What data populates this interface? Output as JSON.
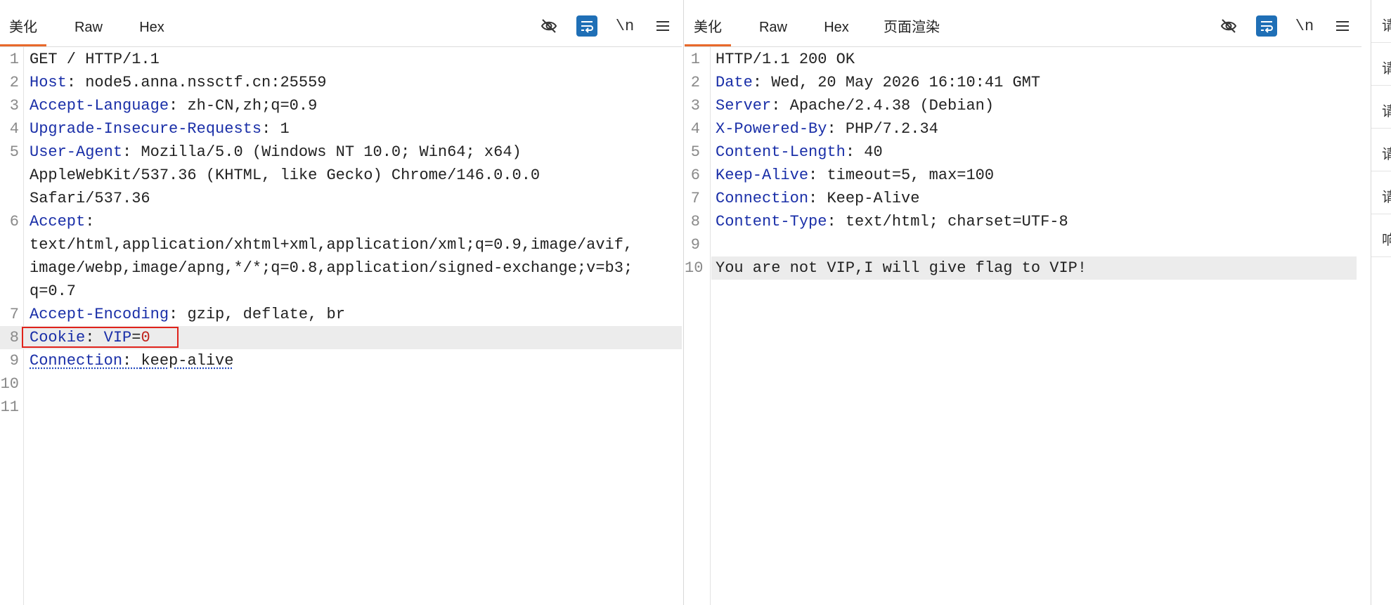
{
  "request": {
    "tabs": [
      {
        "label": "美化",
        "active": true
      },
      {
        "label": "Raw",
        "active": false
      },
      {
        "label": "Hex",
        "active": false
      }
    ],
    "tools": {
      "eye_off": "eye-off-icon",
      "wrap": "wrap-icon",
      "newline": "\\n",
      "menu": "menu-icon"
    },
    "lines": [
      {
        "num": "1",
        "text": "GET / HTTP/1.1"
      },
      {
        "num": "2",
        "key": "Host",
        "sep": ": ",
        "val": "node5.anna.nssctf.cn:25559"
      },
      {
        "num": "3",
        "key": "Accept-Language",
        "sep": ": ",
        "val": "zh-CN,zh;q=0.9"
      },
      {
        "num": "4",
        "key": "Upgrade-Insecure-Requests",
        "sep": ": ",
        "val": "1"
      },
      {
        "num": "5",
        "key": "User-Agent",
        "sep": ": ",
        "val": "Mozilla/5.0 (Windows NT 10.0; Win64; x64)"
      },
      {
        "num": "",
        "text": "AppleWebKit/537.36 (KHTML, like Gecko) Chrome/146.0.0.0"
      },
      {
        "num": "",
        "text": "Safari/537.36"
      },
      {
        "num": "6",
        "key": "Accept",
        "sep": ":",
        "val": ""
      },
      {
        "num": "",
        "text": "text/html,application/xhtml+xml,application/xml;q=0.9,image/avif,"
      },
      {
        "num": "",
        "text": "image/webp,image/apng,*/*;q=0.8,application/signed-exchange;v=b3;"
      },
      {
        "num": "",
        "text": "q=0.7"
      },
      {
        "num": "7",
        "key": "Accept-Encoding",
        "sep": ": ",
        "val": "gzip, deflate, br"
      },
      {
        "num": "8",
        "cookie": {
          "header": "Cookie",
          "sep": ": ",
          "name": "VIP",
          "eq": "=",
          "value": "0"
        }
      },
      {
        "num": "9",
        "key": "Connection",
        "sep": ": ",
        "val": "keep-alive"
      },
      {
        "num": "10",
        "text": ""
      },
      {
        "num": "11",
        "text": ""
      }
    ]
  },
  "response": {
    "tabs": [
      {
        "label": "美化",
        "active": true
      },
      {
        "label": "Raw",
        "active": false
      },
      {
        "label": "Hex",
        "active": false
      },
      {
        "label": "页面渲染",
        "active": false
      }
    ],
    "tools": {
      "eye_off": "eye-off-icon",
      "wrap": "wrap-icon",
      "newline": "\\n",
      "menu": "menu-icon"
    },
    "lines": [
      {
        "num": "1",
        "text": "HTTP/1.1 200 OK"
      },
      {
        "num": "2",
        "key": "Date",
        "sep": ": ",
        "val": "Wed, 20 May 2026 16:10:41 GMT"
      },
      {
        "num": "3",
        "key": "Server",
        "sep": ": ",
        "val": "Apache/2.4.38 (Debian)"
      },
      {
        "num": "4",
        "key": "X-Powered-By",
        "sep": ": ",
        "val": "PHP/7.2.34"
      },
      {
        "num": "5",
        "key": "Content-Length",
        "sep": ": ",
        "val": "40"
      },
      {
        "num": "6",
        "key": "Keep-Alive",
        "sep": ": ",
        "val": "timeout=5, max=100"
      },
      {
        "num": "7",
        "key": "Connection",
        "sep": ": ",
        "val": "Keep-Alive"
      },
      {
        "num": "8",
        "key": "Content-Type",
        "sep": ": ",
        "val": "text/html; charset=UTF-8"
      },
      {
        "num": "9",
        "text": ""
      },
      {
        "num": "10",
        "text": "You are not VIP,I will give flag to VIP!"
      }
    ]
  },
  "side_tabs": [
    "请",
    "请",
    "请",
    "请",
    "请",
    "响"
  ],
  "colors": {
    "accent": "#e8692a",
    "header_key": "#1a2fa8",
    "highlight_box": "#e0231b",
    "wrap_button": "#1f6fb6"
  }
}
